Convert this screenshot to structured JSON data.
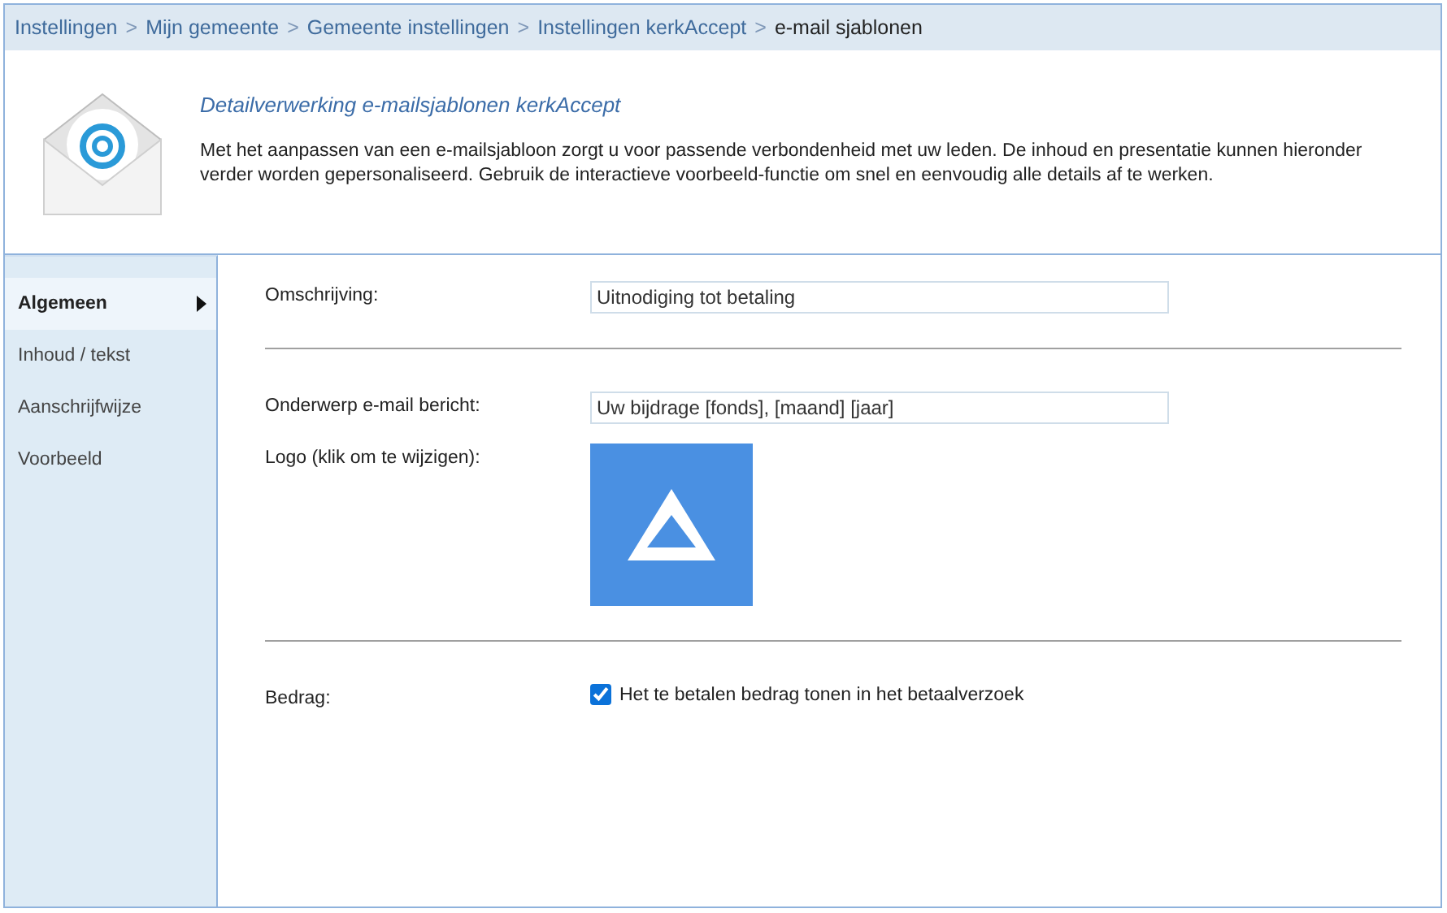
{
  "breadcrumb": [
    {
      "label": "Instellingen",
      "current": false
    },
    {
      "label": "Mijn gemeente",
      "current": false
    },
    {
      "label": "Gemeente instellingen",
      "current": false
    },
    {
      "label": "Instellingen kerkAccept",
      "current": false
    },
    {
      "label": "e-mail sjablonen",
      "current": true
    }
  ],
  "separator": ">",
  "header": {
    "title": "Detailverwerking e-mailsjablonen kerkAccept",
    "description": "Met het aanpassen van een e-mailsjabloon zorgt u voor passende verbondenheid met uw leden. De inhoud en presentatie kunnen hieronder verder worden gepersonaliseerd. Gebruik de interactieve voorbeeld-functie om snel en eenvoudig alle details af te werken."
  },
  "sidebar": {
    "items": [
      {
        "label": "Algemeen",
        "selected": true
      },
      {
        "label": "Inhoud / tekst",
        "selected": false
      },
      {
        "label": "Aanschrijfwijze",
        "selected": false
      },
      {
        "label": "Voorbeeld",
        "selected": false
      }
    ]
  },
  "sections": [
    [
      {
        "kind": "field",
        "label": "Omschrijving:",
        "value": "Uitnodiging tot betaling"
      }
    ],
    [
      {
        "kind": "field",
        "label": "Onderwerp e-mail bericht:",
        "value": "Uw bijdrage [fonds], [maand] [jaar]"
      },
      {
        "kind": "logo",
        "label": "Logo (klik om te wijzigen):"
      }
    ],
    [
      {
        "kind": "checkbox",
        "label": "Bedrag:",
        "text": "Het te betalen bedrag tonen in het betaalverzoek",
        "checked": true
      }
    ]
  ]
}
